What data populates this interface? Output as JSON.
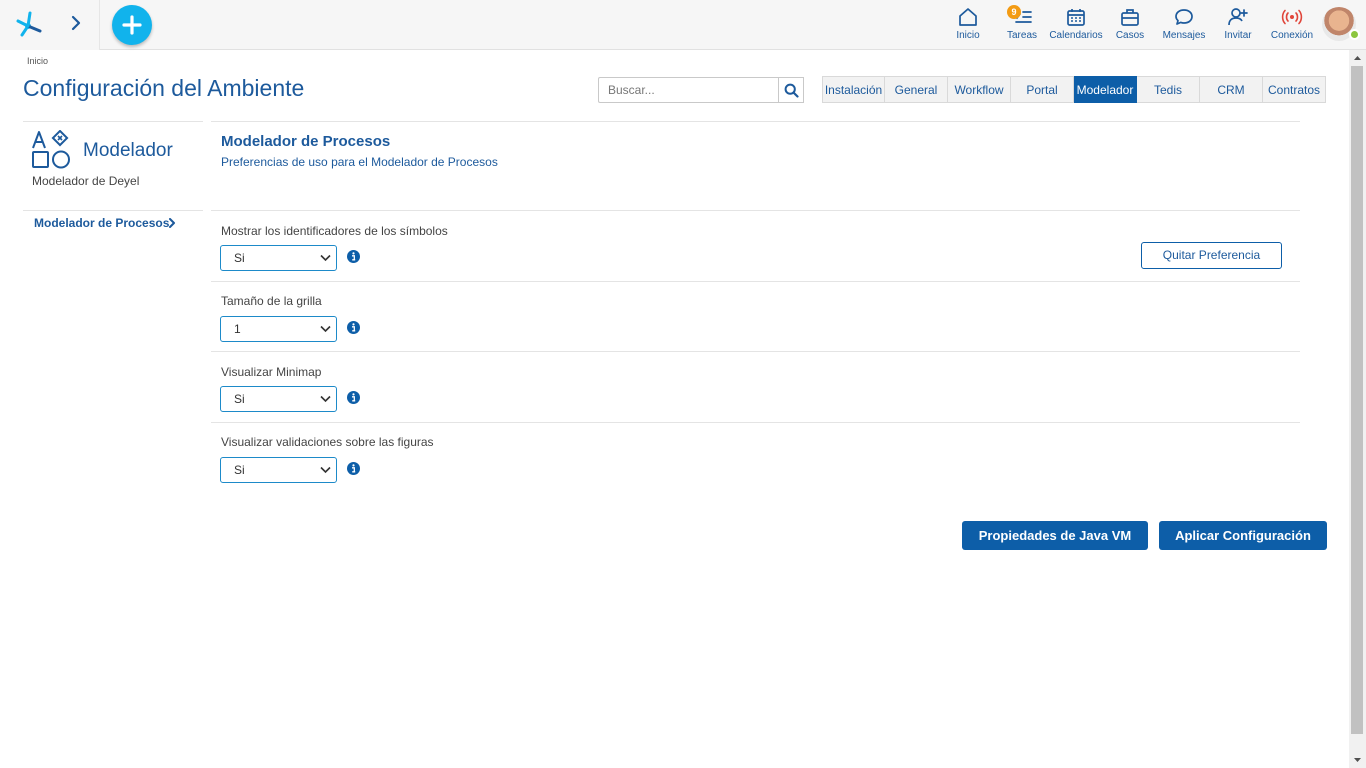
{
  "topnav": {
    "items": [
      {
        "label": "Inicio",
        "icon": "home-icon"
      },
      {
        "label": "Tareas",
        "icon": "tasks-icon",
        "badge": "9"
      },
      {
        "label": "Calendarios",
        "icon": "calendar-icon"
      },
      {
        "label": "Casos",
        "icon": "briefcase-icon"
      },
      {
        "label": "Mensajes",
        "icon": "chat-icon"
      },
      {
        "label": "Invitar",
        "icon": "invite-user-icon"
      },
      {
        "label": "Conexión",
        "icon": "connection-icon"
      }
    ]
  },
  "colors": {
    "brand": "#1d5a9c",
    "primary": "#0d5ea8",
    "accent": "#11b3ec",
    "badge": "#f39b13",
    "online": "#8cc63f",
    "connection": "#e0453a"
  },
  "header": {
    "breadcrumb": "Inicio",
    "title": "Configuración del Ambiente"
  },
  "search": {
    "placeholder": "Buscar..."
  },
  "tabs": [
    {
      "label": "Instalación",
      "active": false
    },
    {
      "label": "General",
      "active": false
    },
    {
      "label": "Workflow",
      "active": false
    },
    {
      "label": "Portal",
      "active": false
    },
    {
      "label": "Modelador",
      "active": true
    },
    {
      "label": "Tedis",
      "active": false
    },
    {
      "label": "CRM",
      "active": false
    },
    {
      "label": "Contratos",
      "active": false
    }
  ],
  "sidebar": {
    "module_title": "Modelador",
    "module_subtitle": "Modelador de Deyel",
    "items": [
      {
        "label": "Modelador de Procesos"
      }
    ]
  },
  "main": {
    "section_title": "Modelador de Procesos",
    "section_description": "Preferencias de uso para el Modelador de Procesos",
    "fields": [
      {
        "label": "Mostrar los identificadores de los símbolos",
        "value": "Si"
      },
      {
        "label": "Tamaño de la grilla",
        "value": "1"
      },
      {
        "label": "Visualizar Minimap",
        "value": "Si"
      },
      {
        "label": "Visualizar validaciones sobre las figuras",
        "value": "Si"
      }
    ],
    "remove_preference_label": "Quitar Preferencia",
    "java_vm_label": "Propiedades de Java VM",
    "apply_label": "Aplicar Configuración"
  }
}
